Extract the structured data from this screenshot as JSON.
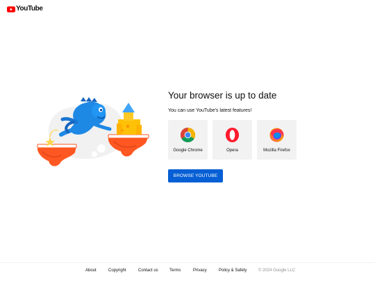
{
  "header": {
    "logo_text": "YouTube"
  },
  "main": {
    "title": "Your browser is up to date",
    "subtitle": "You can use YouTube's latest features!",
    "browsers": [
      {
        "name": "Google Chrome",
        "icon": "chrome-icon"
      },
      {
        "name": "Opera",
        "icon": "opera-icon"
      },
      {
        "name": "Mozilla Firefox",
        "icon": "firefox-icon"
      }
    ],
    "cta_label": "BROWSE YOUTUBE"
  },
  "footer": {
    "links": [
      "About",
      "Copyright",
      "Contact us",
      "Terms",
      "Privacy",
      "Policy & Safety"
    ],
    "copyright": "© 2024 Google LLC"
  },
  "colors": {
    "brand_red": "#ff0000",
    "accent_blue": "#065fd4",
    "card_bg": "#f2f2f2"
  }
}
